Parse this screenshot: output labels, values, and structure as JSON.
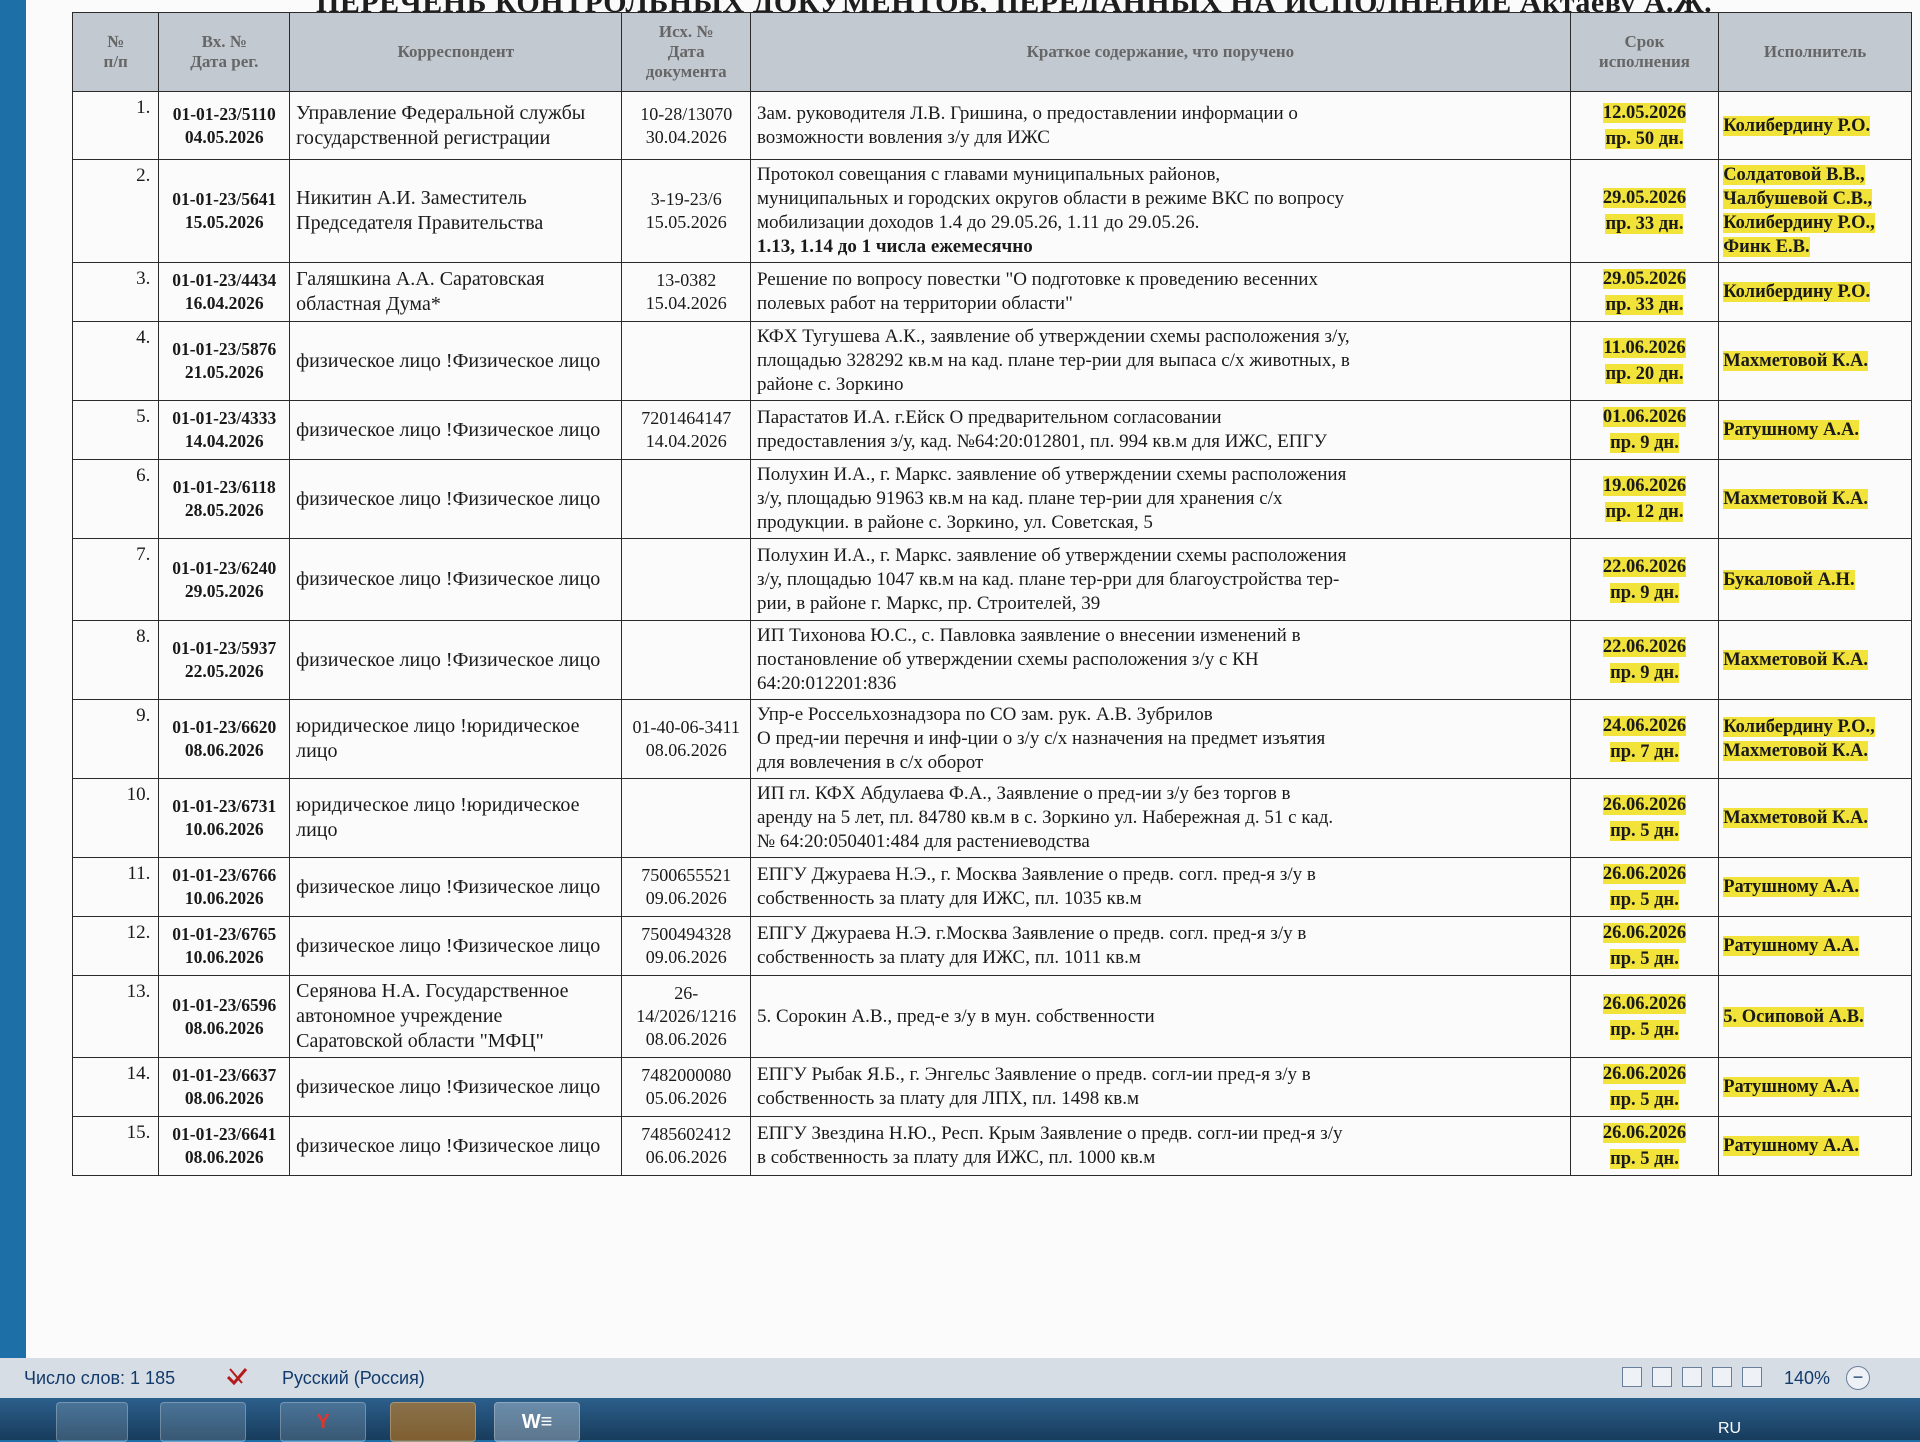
{
  "document": {
    "title": "ПЕРЕЧЕНЬ КОНТРОЛЬНЫХ ДОКУМЕНТОВ, ПЕРЕДАННЫХ НА ИСПОЛНЕНИЕ Актаеву А.Ж.",
    "columns": {
      "num": [
        "№",
        "п/п"
      ],
      "reg": [
        "Вх. №",
        "Дата рег."
      ],
      "correspondent": [
        "Корреспондент"
      ],
      "outgoing": [
        "Исх. №",
        "Дата",
        "документа"
      ],
      "content": [
        "Краткое содержание, что поручено"
      ],
      "deadline": [
        "Срок",
        "исполнения"
      ],
      "executor": [
        "Исполнитель"
      ]
    },
    "rows": [
      {
        "num": "1.",
        "reg_no": "01-01-23/5110",
        "reg_date": "04.05.2026",
        "correspondent": [
          "Управление Федеральной службы",
          "государственной регистрации"
        ],
        "out_no": "10-28/13070",
        "out_date": "30.04.2026",
        "content": [
          "Зам. руководителя Л.В. Гришина, о предоставлении информации о",
          "возможности вовления з/у для ИЖС"
        ],
        "content_bold": [],
        "deadline_date": "12.05.2026",
        "deadline_days": "пр. 50 дн.",
        "executor": [
          "Колибердину Р.О."
        ]
      },
      {
        "num": "2.",
        "reg_no": "01-01-23/5641",
        "reg_date": "15.05.2026",
        "correspondent": [
          "Никитин А.И. Заместитель",
          "Председателя Правительства"
        ],
        "out_no": "3-19-23/6",
        "out_date": "15.05.2026",
        "content": [
          "Протокол совещания с главами муниципальных районов,",
          "муниципальных и городских округов области в режиме ВКС по вопросу",
          "мобилизации доходов      1.4 до 29.05.26,   1.11 до 29.05.26."
        ],
        "content_bold": [
          "1.13, 1.14 до 1 числа ежемесячно"
        ],
        "deadline_date": "29.05.2026",
        "deadline_days": "пр. 33 дн.",
        "executor": [
          "Солдатовой В.В.,",
          "Чалбушевой С.В.,",
          "Колибердину Р.О.,",
          "Финк Е.В."
        ]
      },
      {
        "num": "3.",
        "reg_no": "01-01-23/4434",
        "reg_date": "16.04.2026",
        "correspondent": [
          "Галяшкина А.А. Саратовская",
          "областная Дума*"
        ],
        "out_no": "13-0382",
        "out_date": "15.04.2026",
        "content": [
          "Решение по вопросу повестки \"О подготовке к проведению весенних",
          "полевых работ на территории области\""
        ],
        "content_bold": [],
        "deadline_date": "29.05.2026",
        "deadline_days": "пр. 33 дн.",
        "executor": [
          "Колибердину Р.О."
        ]
      },
      {
        "num": "4.",
        "reg_no": "01-01-23/5876",
        "reg_date": "21.05.2026",
        "correspondent": [
          "физическое лицо !Физическое лицо"
        ],
        "out_no": "",
        "out_date": "",
        "content": [
          "КФХ Тугушева А.К., заявление об утверждении схемы расположения з/у,",
          "площадью 328292 кв.м на кад. плане тер-рии для выпаса с/х животных, в",
          "районе с. Зоркино"
        ],
        "content_bold": [],
        "deadline_date": "11.06.2026",
        "deadline_days": "пр. 20 дн.",
        "executor": [
          "Махметовой К.А."
        ]
      },
      {
        "num": "5.",
        "reg_no": "01-01-23/4333",
        "reg_date": "14.04.2026",
        "correspondent": [
          "физическое лицо !Физическое лицо"
        ],
        "out_no": "7201464147",
        "out_date": "14.04.2026",
        "content": [
          "Парастатов И.А. г.Ейск О предварительном согласовании",
          "предоставления з/у, кад. №64:20:012801, пл. 994 кв.м для ИЖС, ЕПГУ"
        ],
        "content_bold": [],
        "deadline_date": "01.06.2026",
        "deadline_days": "пр. 9 дн.",
        "executor": [
          "Ратушному А.А."
        ]
      },
      {
        "num": "6.",
        "reg_no": "01-01-23/6118",
        "reg_date": "28.05.2026",
        "correspondent": [
          "физическое лицо !Физическое лицо"
        ],
        "out_no": "",
        "out_date": "",
        "content": [
          "Полухин И.А., г. Маркс. заявление об утверждении схемы расположения",
          "з/у, площадью 91963 кв.м на кад. плане тер-рии для хранения с/х",
          "продукции. в районе с. Зоркино, ул. Советская, 5"
        ],
        "content_bold": [],
        "deadline_date": "19.06.2026",
        "deadline_days": "пр. 12 дн.",
        "executor": [
          "Махметовой К.А."
        ]
      },
      {
        "num": "7.",
        "reg_no": "01-01-23/6240",
        "reg_date": "29.05.2026",
        "correspondent": [
          "физическое лицо !Физическое лицо"
        ],
        "out_no": "",
        "out_date": "",
        "content": [
          "Полухин И.А., г. Маркс. заявление об утверждении схемы расположения",
          "з/у, площадью 1047 кв.м на кад. плане тер-рри для благоустройства тер-",
          "рии, в районе г. Маркс, пр. Строителей, 39"
        ],
        "content_bold": [],
        "deadline_date": "22.06.2026",
        "deadline_days": "пр. 9 дн.",
        "executor": [
          "Букаловой А.Н."
        ]
      },
      {
        "num": "8.",
        "reg_no": "01-01-23/5937",
        "reg_date": "22.05.2026",
        "correspondent": [
          "физическое лицо !Физическое лицо"
        ],
        "out_no": "",
        "out_date": "",
        "content": [
          "ИП Тихонова Ю.С., с. Павловка заявление о внесении изменений в",
          "постановление об утверждении схемы расположения з/у с КН",
          "64:20:012201:836"
        ],
        "content_bold": [],
        "deadline_date": "22.06.2026",
        "deadline_days": "пр. 9 дн.",
        "executor": [
          "Махметовой К.А."
        ]
      },
      {
        "num": "9.",
        "reg_no": "01-01-23/6620",
        "reg_date": "08.06.2026",
        "correspondent": [
          "юридическое лицо !юридическое",
          "лицо"
        ],
        "out_no": "01-40-06-3411",
        "out_date": "08.06.2026",
        "content": [
          "Упр-е Россельхознадзора по СО зам. рук. А.В. Зубрилов",
          "О пред-ии перечня и инф-ции  о з/у с/х назначения на предмет изъятия",
          "для вовлечения в с/х оборот"
        ],
        "content_bold": [],
        "deadline_date": "24.06.2026",
        "deadline_days": "пр. 7 дн.",
        "executor": [
          "Колибердину Р.О.,",
          "Махметовой К.А."
        ]
      },
      {
        "num": "10.",
        "reg_no": "01-01-23/6731",
        "reg_date": "10.06.2026",
        "correspondent": [
          "юридическое лицо !юридическое",
          "лицо"
        ],
        "out_no": "",
        "out_date": "",
        "content": [
          "ИП гл. КФХ Абдулаева Ф.А.,  Заявление о пред-ии з/у без торгов в",
          "аренду на 5 лет, пл. 84780 кв.м в с. Зоркино ул. Набережная д. 51 с кад.",
          "№ 64:20:050401:484 для растениеводства"
        ],
        "content_bold": [],
        "deadline_date": "26.06.2026",
        "deadline_days": "пр. 5 дн.",
        "executor": [
          "Махметовой К.А."
        ]
      },
      {
        "num": "11.",
        "reg_no": "01-01-23/6766",
        "reg_date": "10.06.2026",
        "correspondent": [
          "физическое лицо !Физическое лицо"
        ],
        "out_no": "7500655521",
        "out_date": "09.06.2026",
        "content": [
          "ЕПГУ Джураева Н.Э., г. Москва Заявление о предв. согл. пред-я з/у в",
          "собственность за плату для ИЖС, пл. 1035 кв.м"
        ],
        "content_bold": [],
        "deadline_date": "26.06.2026",
        "deadline_days": "пр. 5 дн.",
        "executor": [
          "Ратушному А.А."
        ]
      },
      {
        "num": "12.",
        "reg_no": "01-01-23/6765",
        "reg_date": "10.06.2026",
        "correspondent": [
          "физическое лицо !Физическое лицо"
        ],
        "out_no": "7500494328",
        "out_date": "09.06.2026",
        "content": [
          "ЕПГУ Джураева Н.Э. г.Москва Заявление о предв. согл. пред-я з/у в",
          "собственность за плату для ИЖС, пл. 1011 кв.м"
        ],
        "content_bold": [],
        "deadline_date": "26.06.2026",
        "deadline_days": "пр. 5 дн.",
        "executor": [
          "Ратушному А.А."
        ]
      },
      {
        "num": "13.",
        "reg_no": "01-01-23/6596",
        "reg_date": "08.06.2026",
        "correspondent": [
          "Серянова Н.А. Государственное",
          "автономное учреждение",
          "Саратовской области \"МФЦ\""
        ],
        "out_no": "26-14/2026/1216",
        "out_date": "08.06.2026",
        "content": [
          "5. Сорокин А.В., пред-е з/у в мун. собственности"
        ],
        "content_bold": [],
        "deadline_date": "26.06.2026",
        "deadline_days": "пр. 5 дн.",
        "executor": [
          "5. Осиповой А.В."
        ]
      },
      {
        "num": "14.",
        "reg_no": "01-01-23/6637",
        "reg_date": "08.06.2026",
        "correspondent": [
          "физическое лицо !Физическое лицо"
        ],
        "out_no": "7482000080",
        "out_date": "05.06.2026",
        "content": [
          "ЕПГУ Рыбак Я.Б., г. Энгельс Заявление о предв. согл-ии пред-я з/у в",
          "собственность за плату для ЛПХ, пл. 1498 кв.м"
        ],
        "content_bold": [],
        "deadline_date": "26.06.2026",
        "deadline_days": "пр. 5 дн.",
        "executor": [
          "Ратушному А.А."
        ]
      },
      {
        "num": "15.",
        "reg_no": "01-01-23/6641",
        "reg_date": "08.06.2026",
        "correspondent": [
          "физическое лицо !Физическое лицо"
        ],
        "out_no": "7485602412",
        "out_date": "06.06.2026",
        "content": [
          "ЕПГУ Звездина Н.Ю., Респ. Крым Заявление о предв. согл-ии пред-я з/у",
          "в собственность за плату для ИЖС, пл. 1000 кв.м"
        ],
        "content_bold": [],
        "deadline_date": "26.06.2026",
        "deadline_days": "пр. 5 дн.",
        "executor": [
          "Ратушному А.А."
        ]
      }
    ]
  },
  "statusbar": {
    "word_count": "Число слов: 1 185",
    "language": "Русский (Россия)",
    "zoom": "140%",
    "zoom_out_symbol": "−"
  },
  "taskbar": {
    "apps": [
      "",
      "",
      "Y",
      "",
      "W≡"
    ],
    "tray_lang": "RU"
  },
  "colors": {
    "highlight": "#f2e33a",
    "header_bg": "#c2c9d1",
    "desktop": "#1d6fa8"
  }
}
